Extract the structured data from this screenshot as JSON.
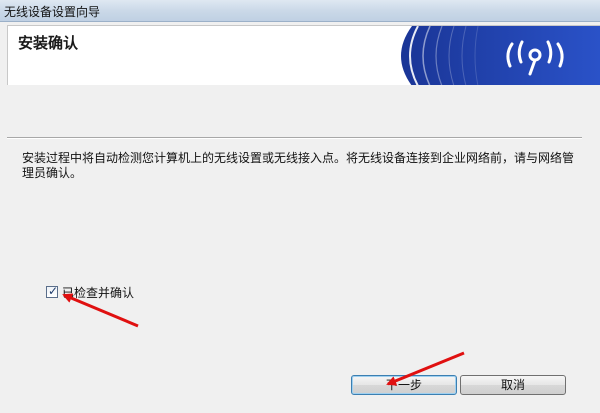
{
  "window": {
    "title": "无线设备设置向导"
  },
  "header": {
    "title": "安装确认",
    "logo_icon": "wireless-signal-icon"
  },
  "main": {
    "message": "安装过程中将自动检测您计算机上的无线设置或无线接入点。将无线设备连接到企业网络前，请与网络管理员确认。",
    "checkbox": {
      "label": "已检查并确认",
      "checked": true
    }
  },
  "buttons": {
    "next_label": "下一步",
    "cancel_label": "取消"
  },
  "colors": {
    "banner_blue": "#1f3fa8",
    "annotation_red": "#e01010"
  }
}
